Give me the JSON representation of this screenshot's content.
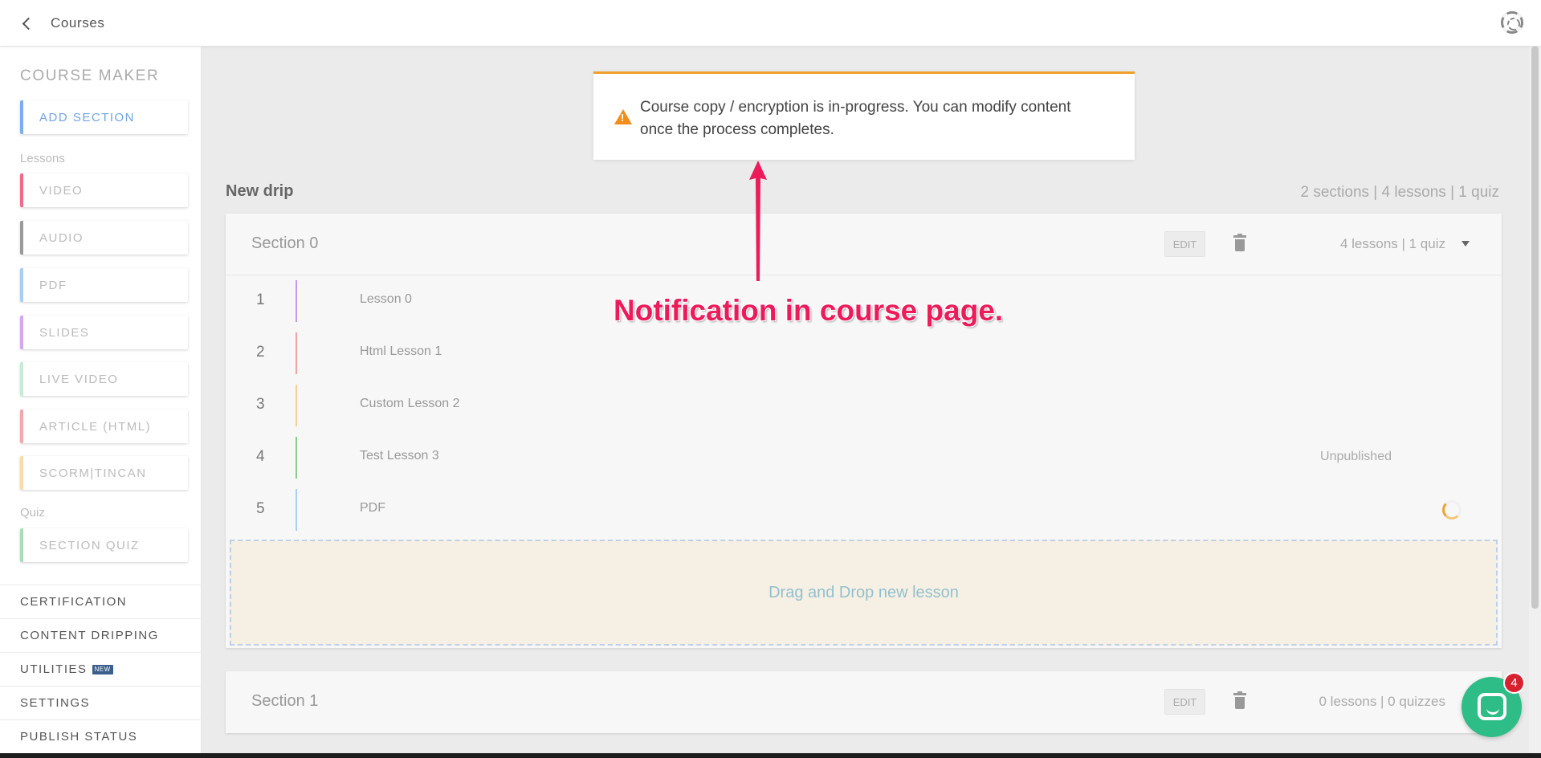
{
  "header": {
    "back_label": "Courses"
  },
  "sidebar": {
    "title": "COURSE MAKER",
    "add_section": "ADD SECTION",
    "lessons_group": "Lessons",
    "lesson_types": [
      {
        "label": "VIDEO",
        "color": "#f06b8a"
      },
      {
        "label": "AUDIO",
        "color": "#9a9a9a"
      },
      {
        "label": "PDF",
        "color": "#a9cdf6"
      },
      {
        "label": "SLIDES",
        "color": "#d7a6f3"
      },
      {
        "label": "LIVE VIDEO",
        "color": "#c7ecd6"
      },
      {
        "label": "ARTICLE (HTML)",
        "color": "#f5a7ab"
      },
      {
        "label": "SCORM|TINCAN",
        "color": "#f7dcaa"
      }
    ],
    "add_section_color": "#7ab0f0",
    "quiz_group": "Quiz",
    "quiz_type": {
      "label": "SECTION QUIZ",
      "color": "#a8ddb7"
    },
    "links": [
      "CERTIFICATION",
      "CONTENT DRIPPING",
      "UTILITIES",
      "SETTINGS",
      "PUBLISH STATUS"
    ],
    "new_badge": "NEW"
  },
  "notification": {
    "message": "Course copy / encryption is in-progress. You can modify content once the process completes.",
    "accent": "#f0a12b"
  },
  "drip": {
    "title": "New drip",
    "stats": "2 sections | 4 lessons | 1 quiz"
  },
  "sections": [
    {
      "name": "Section 0",
      "edit": "EDIT",
      "count": "4 lessons | 1 quiz",
      "lessons": [
        {
          "num": "1",
          "title": "Lesson 0",
          "color": "#c79ae6",
          "status": ""
        },
        {
          "num": "2",
          "title": "Html Lesson 1",
          "color": "#f2a3a8",
          "status": ""
        },
        {
          "num": "3",
          "title": "Custom Lesson 2",
          "color": "#f7cf99",
          "status": ""
        },
        {
          "num": "4",
          "title": "Test Lesson 3",
          "color": "#8fcb8f",
          "status": "Unpublished"
        },
        {
          "num": "5",
          "title": "PDF",
          "color": "#a9cdf6",
          "status": ""
        }
      ],
      "dropzone": "Drag and Drop new lesson"
    },
    {
      "name": "Section 1",
      "edit": "EDIT",
      "count": "0 lessons | 0 quizzes"
    }
  ],
  "annotation": {
    "text": "Notification in course page.",
    "color": "#ec1b5a"
  },
  "chat": {
    "badge": "4"
  }
}
